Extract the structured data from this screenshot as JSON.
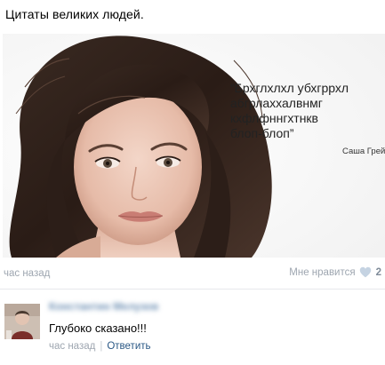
{
  "post": {
    "title": "Цитаты великих людей.",
    "image": {
      "quote": "“Брхглхлхл убхгррхл\nабгрлаххалвнмг\nкхфлфннгхтнкв\nблоп-блоп”",
      "author": "Саша Грей"
    },
    "time": "час назад",
    "like_label": "Мне нравится",
    "like_count": "2"
  },
  "comment": {
    "author": "Константин Мелузов",
    "text": "Глубоко сказано!!!",
    "time": "час назад",
    "separator": "|",
    "reply_label": "Ответить"
  },
  "colors": {
    "link": "#2a5885",
    "muted": "#9ea6b0",
    "author": "#6d8fb3"
  },
  "icons": {
    "like": "heart-icon"
  }
}
